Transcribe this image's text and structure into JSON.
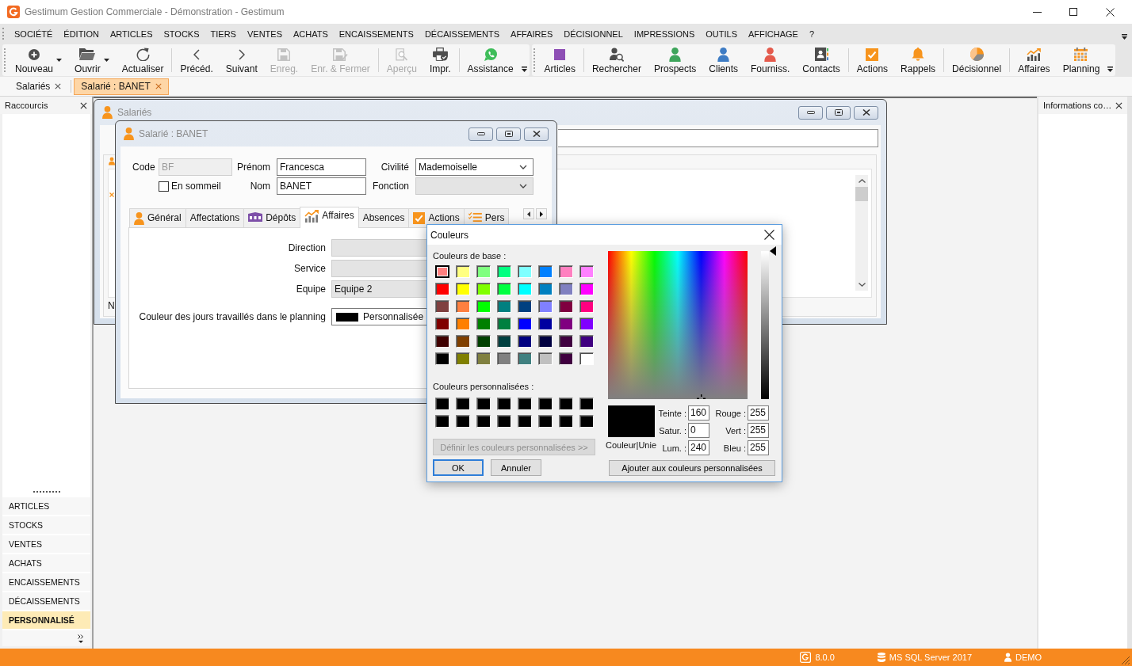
{
  "window": {
    "title": "Gestimum Gestion Commerciale - Démonstration - Gestimum"
  },
  "menu_bar": {
    "items": [
      "SOCIÉTÉ",
      "ÉDITION",
      "ARTICLES",
      "STOCKS",
      "TIERS",
      "VENTES",
      "ACHATS",
      "ENCAISSEMENTS",
      "DÉCAISSEMENTS",
      "AFFAIRES",
      "DÉCISIONNEL",
      "IMPRESSIONS",
      "OUTILS",
      "AFFICHAGE",
      "?"
    ]
  },
  "toolbars": [
    {
      "groups": [
        {
          "items": [
            {
              "label": "Nouveau",
              "kind": "plus",
              "dropdown": true,
              "disabled": false
            },
            {
              "label": "Ouvrir",
              "kind": "folder",
              "dropdown": true,
              "disabled": false
            },
            {
              "label": "Actualiser",
              "kind": "refresh",
              "dropdown": false,
              "disabled": false
            }
          ]
        },
        {
          "items": [
            {
              "label": "Précéd.",
              "kind": "left",
              "dropdown": false,
              "disabled": false
            },
            {
              "label": "Suivant",
              "kind": "right",
              "dropdown": false,
              "disabled": false
            },
            {
              "label": "Enreg.",
              "kind": "disk",
              "dropdown": false,
              "disabled": true
            },
            {
              "label": "Enr. & Fermer",
              "kind": "diskcheck",
              "dropdown": false,
              "disabled": true
            }
          ]
        },
        {
          "items": [
            {
              "label": "Aperçu",
              "kind": "preview",
              "dropdown": false,
              "disabled": true
            },
            {
              "label": "Impr.",
              "kind": "printer",
              "dropdown": false,
              "disabled": false
            }
          ]
        },
        {
          "items": [
            {
              "label": "Assistance",
              "kind": "chat",
              "dropdown": false,
              "disabled": false
            }
          ]
        }
      ]
    },
    {
      "groups": [
        {
          "items": [
            {
              "label": "Articles",
              "kind": "box",
              "dropdown": false,
              "disabled": false
            }
          ]
        },
        {
          "items": [
            {
              "label": "Rechercher",
              "kind": "finder",
              "dropdown": false,
              "disabled": false
            },
            {
              "label": "Prospects",
              "kind": "person",
              "color": "#3ea55b",
              "dropdown": false,
              "disabled": false
            },
            {
              "label": "Clients",
              "kind": "person",
              "color": "#3e7cc4",
              "dropdown": false,
              "disabled": false
            },
            {
              "label": "Fourniss.",
              "kind": "person",
              "color": "#e45a4c",
              "dropdown": false,
              "disabled": false
            },
            {
              "label": "Contacts",
              "kind": "card",
              "dropdown": false,
              "disabled": false
            }
          ]
        },
        {
          "items": [
            {
              "label": "Actions",
              "kind": "check",
              "dropdown": false,
              "disabled": false
            },
            {
              "label": "Rappels",
              "kind": "bell",
              "dropdown": false,
              "disabled": false
            }
          ]
        },
        {
          "items": [
            {
              "label": "Décisionnel",
              "kind": "pie",
              "dropdown": false,
              "disabled": false
            }
          ]
        },
        {
          "items": [
            {
              "label": "Affaires",
              "kind": "growth",
              "dropdown": false,
              "disabled": false
            },
            {
              "label": "Planning",
              "kind": "calendar",
              "dropdown": false,
              "disabled": false
            }
          ]
        }
      ]
    }
  ],
  "document_tabs": [
    {
      "label": "Salariés",
      "selected": false
    },
    {
      "label": "Salarié : BANET",
      "selected": true
    }
  ],
  "shortcuts_panel": {
    "title": "Raccourcis",
    "items": [
      {
        "label": "ARTICLES",
        "selected": false
      },
      {
        "label": "STOCKS",
        "selected": false
      },
      {
        "label": "VENTES",
        "selected": false
      },
      {
        "label": "ACHATS",
        "selected": false
      },
      {
        "label": "ENCAISSEMENTS",
        "selected": false
      },
      {
        "label": "DÉCAISSEMENTS",
        "selected": false
      },
      {
        "label": "PERSONNALISÉ",
        "selected": true
      }
    ]
  },
  "employees_window": {
    "title": "Salariés",
    "partial_text": "N"
  },
  "employee_window": {
    "title": "Salarié : BANET",
    "code": {
      "label": "Code",
      "value": "BF",
      "disabled": true
    },
    "first_name": {
      "label": "Prénom",
      "value": "Francesca",
      "disabled": false
    },
    "civility": {
      "label": "Civilité",
      "value": "Mademoiselle",
      "disabled": false
    },
    "dormant": {
      "label": "En sommeil",
      "checked": false
    },
    "last_name": {
      "label": "Nom",
      "value": "BANET",
      "disabled": false
    },
    "function": {
      "label": "Fonction",
      "disabled": true
    },
    "tabs": [
      {
        "label": "Général",
        "kind": "person",
        "selected": false
      },
      {
        "label": "Affectations",
        "kind": "plain",
        "selected": false
      },
      {
        "label": "Dépôts",
        "kind": "building",
        "selected": false
      },
      {
        "label": "Affaires",
        "kind": "growth",
        "selected": true
      },
      {
        "label": "Absences",
        "kind": "plain",
        "selected": false
      },
      {
        "label": "Actions",
        "kind": "check",
        "selected": false
      },
      {
        "label": "Pers",
        "kind": "checklist",
        "selected": false
      }
    ],
    "tab_fields": [
      {
        "label": "Direction",
        "disabled": true
      },
      {
        "label": "Service",
        "disabled": true
      },
      {
        "label": "Equipe",
        "value": "Equipe 2",
        "disabled": true
      }
    ],
    "planning_color": {
      "label": "Couleur des jours travaillés dans le planning",
      "value": "Personnalisée"
    }
  },
  "color_dialog": {
    "title": "Couleurs",
    "basic_label": "Couleurs de base :",
    "basic_colors": [
      {
        "color": "#ff8080",
        "selected": true
      },
      {
        "color": "#ffff80",
        "selected": false
      },
      {
        "color": "#80ff80",
        "selected": false
      },
      {
        "color": "#00ff80",
        "selected": false
      },
      {
        "color": "#80ffff",
        "selected": false
      },
      {
        "color": "#0080ff",
        "selected": false
      },
      {
        "color": "#ff80c0",
        "selected": false
      },
      {
        "color": "#ff80ff",
        "selected": false
      },
      {
        "color": "#ff0000",
        "selected": false
      },
      {
        "color": "#ffff00",
        "selected": false
      },
      {
        "color": "#80ff00",
        "selected": false
      },
      {
        "color": "#00ff40",
        "selected": false
      },
      {
        "color": "#00ffff",
        "selected": false
      },
      {
        "color": "#0080c0",
        "selected": false
      },
      {
        "color": "#8080c0",
        "selected": false
      },
      {
        "color": "#ff00ff",
        "selected": false
      },
      {
        "color": "#804040",
        "selected": false
      },
      {
        "color": "#ff8040",
        "selected": false
      },
      {
        "color": "#00ff00",
        "selected": false
      },
      {
        "color": "#008080",
        "selected": false
      },
      {
        "color": "#004080",
        "selected": false
      },
      {
        "color": "#8080ff",
        "selected": false
      },
      {
        "color": "#800040",
        "selected": false
      },
      {
        "color": "#ff0080",
        "selected": false
      },
      {
        "color": "#800000",
        "selected": false
      },
      {
        "color": "#ff8000",
        "selected": false
      },
      {
        "color": "#008000",
        "selected": false
      },
      {
        "color": "#008040",
        "selected": false
      },
      {
        "color": "#0000ff",
        "selected": false
      },
      {
        "color": "#0000a0",
        "selected": false
      },
      {
        "color": "#800080",
        "selected": false
      },
      {
        "color": "#8000ff",
        "selected": false
      },
      {
        "color": "#400000",
        "selected": false
      },
      {
        "color": "#804000",
        "selected": false
      },
      {
        "color": "#004000",
        "selected": false
      },
      {
        "color": "#004040",
        "selected": false
      },
      {
        "color": "#000080",
        "selected": false
      },
      {
        "color": "#000040",
        "selected": false
      },
      {
        "color": "#400040",
        "selected": false
      },
      {
        "color": "#400080",
        "selected": false
      },
      {
        "color": "#000000",
        "selected": false
      },
      {
        "color": "#808000",
        "selected": false
      },
      {
        "color": "#808040",
        "selected": false
      },
      {
        "color": "#808080",
        "selected": false
      },
      {
        "color": "#408080",
        "selected": false
      },
      {
        "color": "#c0c0c0",
        "selected": false
      },
      {
        "color": "#400040",
        "selected": false
      },
      {
        "color": "#ffffff",
        "selected": false
      }
    ],
    "custom_label": "Couleurs personnalisées :",
    "custom_colors": [
      {
        "color": "#000000",
        "selected": false
      },
      {
        "color": "#000000",
        "selected": false
      },
      {
        "color": "#000000",
        "selected": false
      },
      {
        "color": "#000000",
        "selected": false
      },
      {
        "color": "#000000",
        "selected": false
      },
      {
        "color": "#000000",
        "selected": false
      },
      {
        "color": "#000000",
        "selected": false
      },
      {
        "color": "#000000",
        "selected": false
      },
      {
        "color": "#000000",
        "selected": false
      },
      {
        "color": "#000000",
        "selected": false
      },
      {
        "color": "#000000",
        "selected": false
      },
      {
        "color": "#000000",
        "selected": false
      },
      {
        "color": "#000000",
        "selected": false
      },
      {
        "color": "#000000",
        "selected": false
      },
      {
        "color": "#000000",
        "selected": false
      },
      {
        "color": "#000000",
        "selected": false
      }
    ],
    "define_button": {
      "label": "Définir les couleurs personnalisées >>",
      "disabled": true
    },
    "buttons": [
      {
        "label": "OK",
        "default": true
      },
      {
        "label": "Annuler",
        "default": false
      }
    ],
    "luminance": {
      "level": 1
    },
    "preview_label": "Couleur|Unie",
    "hsl_fields": [
      {
        "label": "Teinte :",
        "value": "160"
      },
      {
        "label": "Satur. :",
        "value": "0"
      },
      {
        "label": "Lum. :",
        "value": "240"
      }
    ],
    "rgb_fields": [
      {
        "label": "Rouge :",
        "value": "255"
      },
      {
        "label": "Vert :",
        "value": "255"
      },
      {
        "label": "Bleu :",
        "value": "255"
      }
    ],
    "add_button": "Ajouter aux couleurs personnalisées"
  },
  "info_panel": {
    "title": "Informations co…"
  },
  "status_bar": {
    "items": [
      {
        "kind": "version",
        "text": "8.0.0"
      },
      {
        "kind": "database",
        "text": "MS SQL Server 2017"
      },
      {
        "kind": "user",
        "text": "DEMO"
      }
    ]
  }
}
